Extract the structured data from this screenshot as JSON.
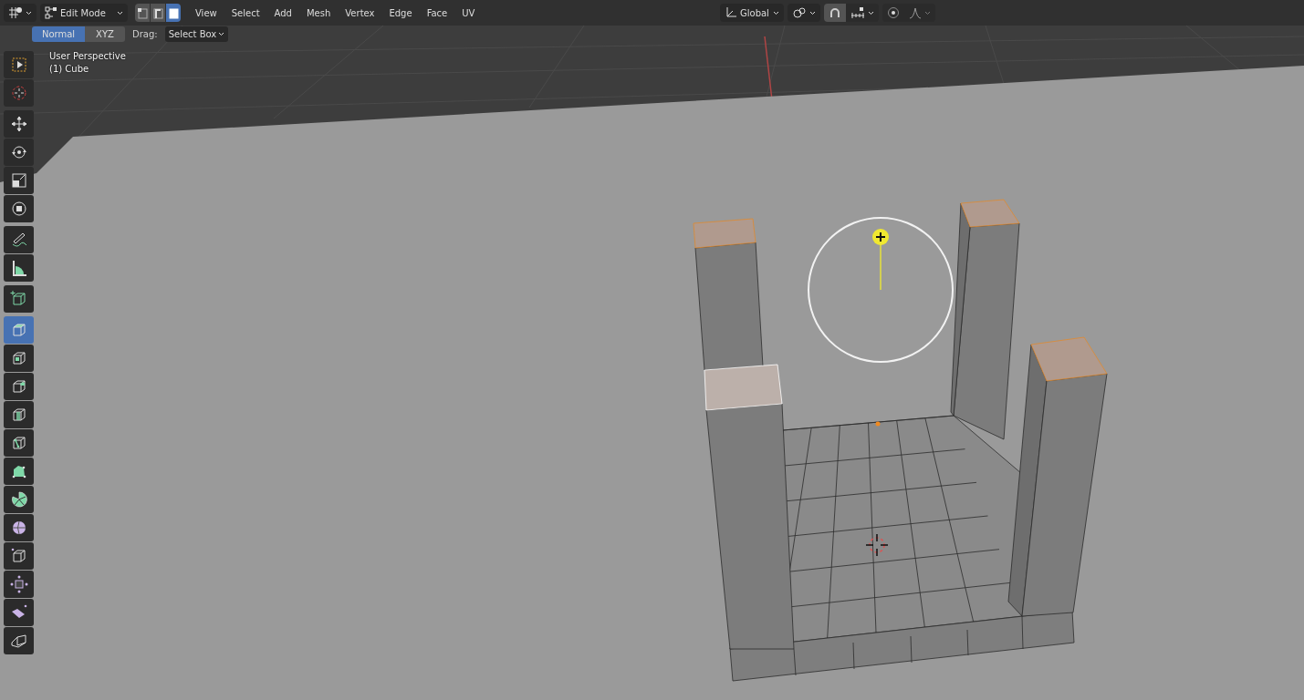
{
  "header": {
    "mode": "Edit Mode",
    "select_modes": [
      {
        "kind": "vertex",
        "selected": false
      },
      {
        "kind": "edge",
        "selected": false
      },
      {
        "kind": "face",
        "selected": true
      }
    ],
    "menus": [
      "View",
      "Select",
      "Add",
      "Mesh",
      "Vertex",
      "Edge",
      "Face",
      "UV"
    ],
    "orientation": "Global"
  },
  "tool_settings": {
    "orient_buttons": [
      {
        "label": "Normal",
        "selected": true
      },
      {
        "label": "XYZ",
        "selected": false
      }
    ],
    "drag_label": "Drag:",
    "drag_value": "Select Box"
  },
  "viewport": {
    "overlay_text": [
      "User Perspective",
      "(1) Cube"
    ]
  },
  "toolbar": {
    "groups": [
      {
        "tools": [
          {
            "kind": "select-box",
            "selected": false
          },
          {
            "kind": "cursor",
            "selected": false
          }
        ]
      },
      {
        "tools": [
          {
            "kind": "move",
            "selected": false
          },
          {
            "kind": "rotate",
            "selected": false
          },
          {
            "kind": "scale",
            "selected": false
          },
          {
            "kind": "transform",
            "selected": false
          }
        ]
      },
      {
        "tools": [
          {
            "kind": "annotate",
            "selected": false
          },
          {
            "kind": "measure",
            "selected": false
          }
        ]
      },
      {
        "tools": [
          {
            "kind": "add-cube",
            "selected": false
          }
        ]
      },
      {
        "tools": [
          {
            "kind": "extrude",
            "selected": true
          },
          {
            "kind": "inset",
            "selected": false
          },
          {
            "kind": "bevel",
            "selected": false
          },
          {
            "kind": "loop-cut",
            "selected": false
          },
          {
            "kind": "knife",
            "selected": false
          },
          {
            "kind": "poly-build",
            "selected": false
          },
          {
            "kind": "spin",
            "selected": false
          },
          {
            "kind": "smooth",
            "selected": false
          },
          {
            "kind": "randomize",
            "selected": false
          },
          {
            "kind": "push",
            "selected": false
          },
          {
            "kind": "shear",
            "selected": false
          },
          {
            "kind": "rip",
            "selected": false
          }
        ]
      }
    ]
  }
}
